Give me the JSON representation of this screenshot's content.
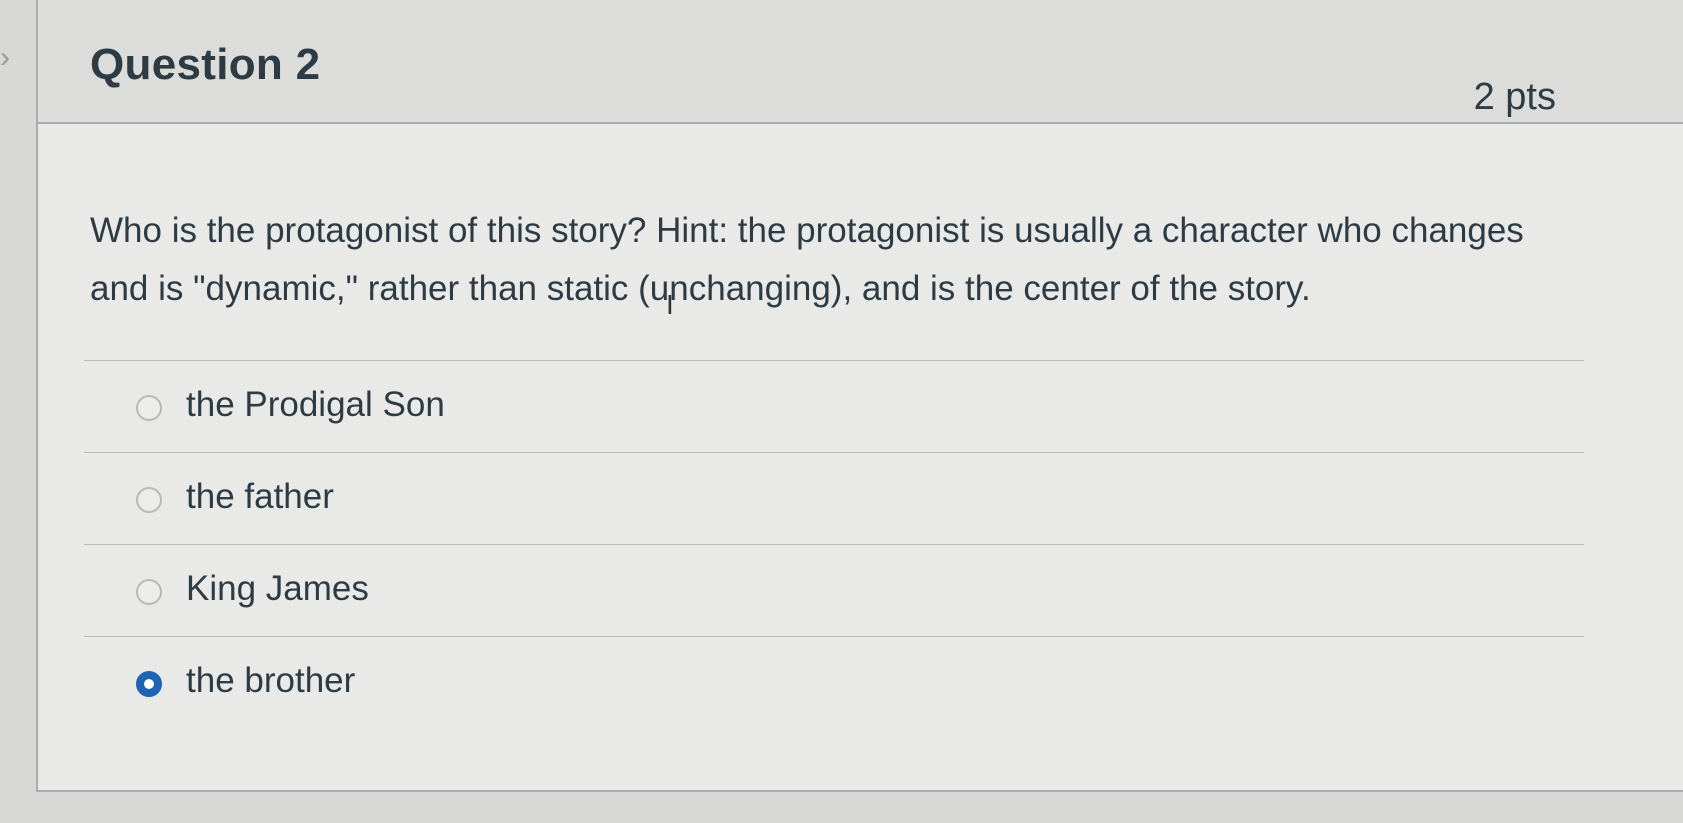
{
  "question": {
    "title": "Question 2",
    "points": "2 pts",
    "text": "Who is the protagonist of this story? Hint: the protagonist is usually a character who changes and is \"dynamic,\" rather than static (unchanging),  and is the center of the story."
  },
  "answers": [
    {
      "label": "the Prodigal Son",
      "selected": false
    },
    {
      "label": "the father",
      "selected": false
    },
    {
      "label": "King James",
      "selected": false
    },
    {
      "label": "the brother",
      "selected": true
    }
  ],
  "colors": {
    "accent": "#1e63b4",
    "text": "#2d3b45",
    "border": "#a9adaf"
  },
  "icons": {
    "collapse": "chevron-right-icon",
    "cursor": "text-cursor-icon"
  }
}
